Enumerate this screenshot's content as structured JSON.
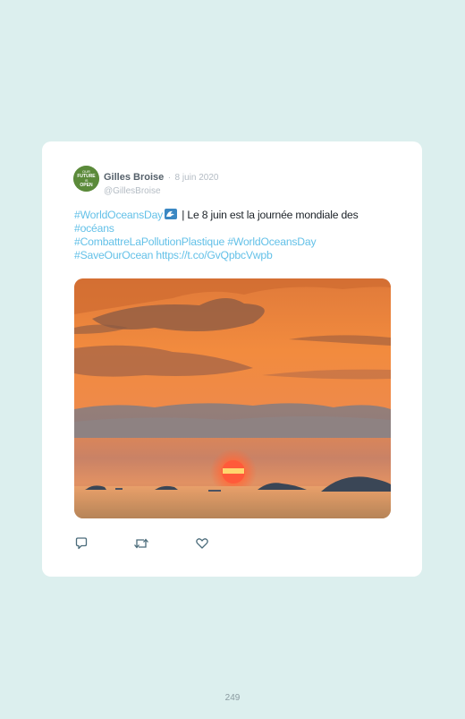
{
  "tweet": {
    "author": {
      "display_name": "Gilles Broise",
      "handle": "@GillesBroise",
      "avatar_text": [
        "OUR",
        "FUTURE",
        "IS",
        "OPEN"
      ]
    },
    "separator": "·",
    "date": "8 juin 2020",
    "text": {
      "hashtag_world_oceans_day_1": "#WorldOceansDay",
      "emoji": "wave-emoji",
      "sentence_part_1": " | Le 8 juin est la journée mondiale des ",
      "hashtag_oceans": "#océans",
      "hashtag_combattre": "#CombattreLaPollutionPlastique",
      "hashtag_world_oceans_day_2": "#WorldOceansDay",
      "hashtag_save_our_ocean": "#SaveOurOcean",
      "link": "https://t.co/GvQpbcVwpb"
    },
    "photo": {
      "description_icon": "sunset-photo"
    },
    "actions": [
      {
        "name": "reply",
        "icon": "speech-bubble-icon"
      },
      {
        "name": "retweet",
        "icon": "retweet-icon"
      },
      {
        "name": "like",
        "icon": "heart-icon"
      }
    ]
  },
  "colors": {
    "background": "#dcefee",
    "hashtag": "#64c1e8",
    "action_icon": "#4a6b7a"
  },
  "page": {
    "number": "249"
  }
}
